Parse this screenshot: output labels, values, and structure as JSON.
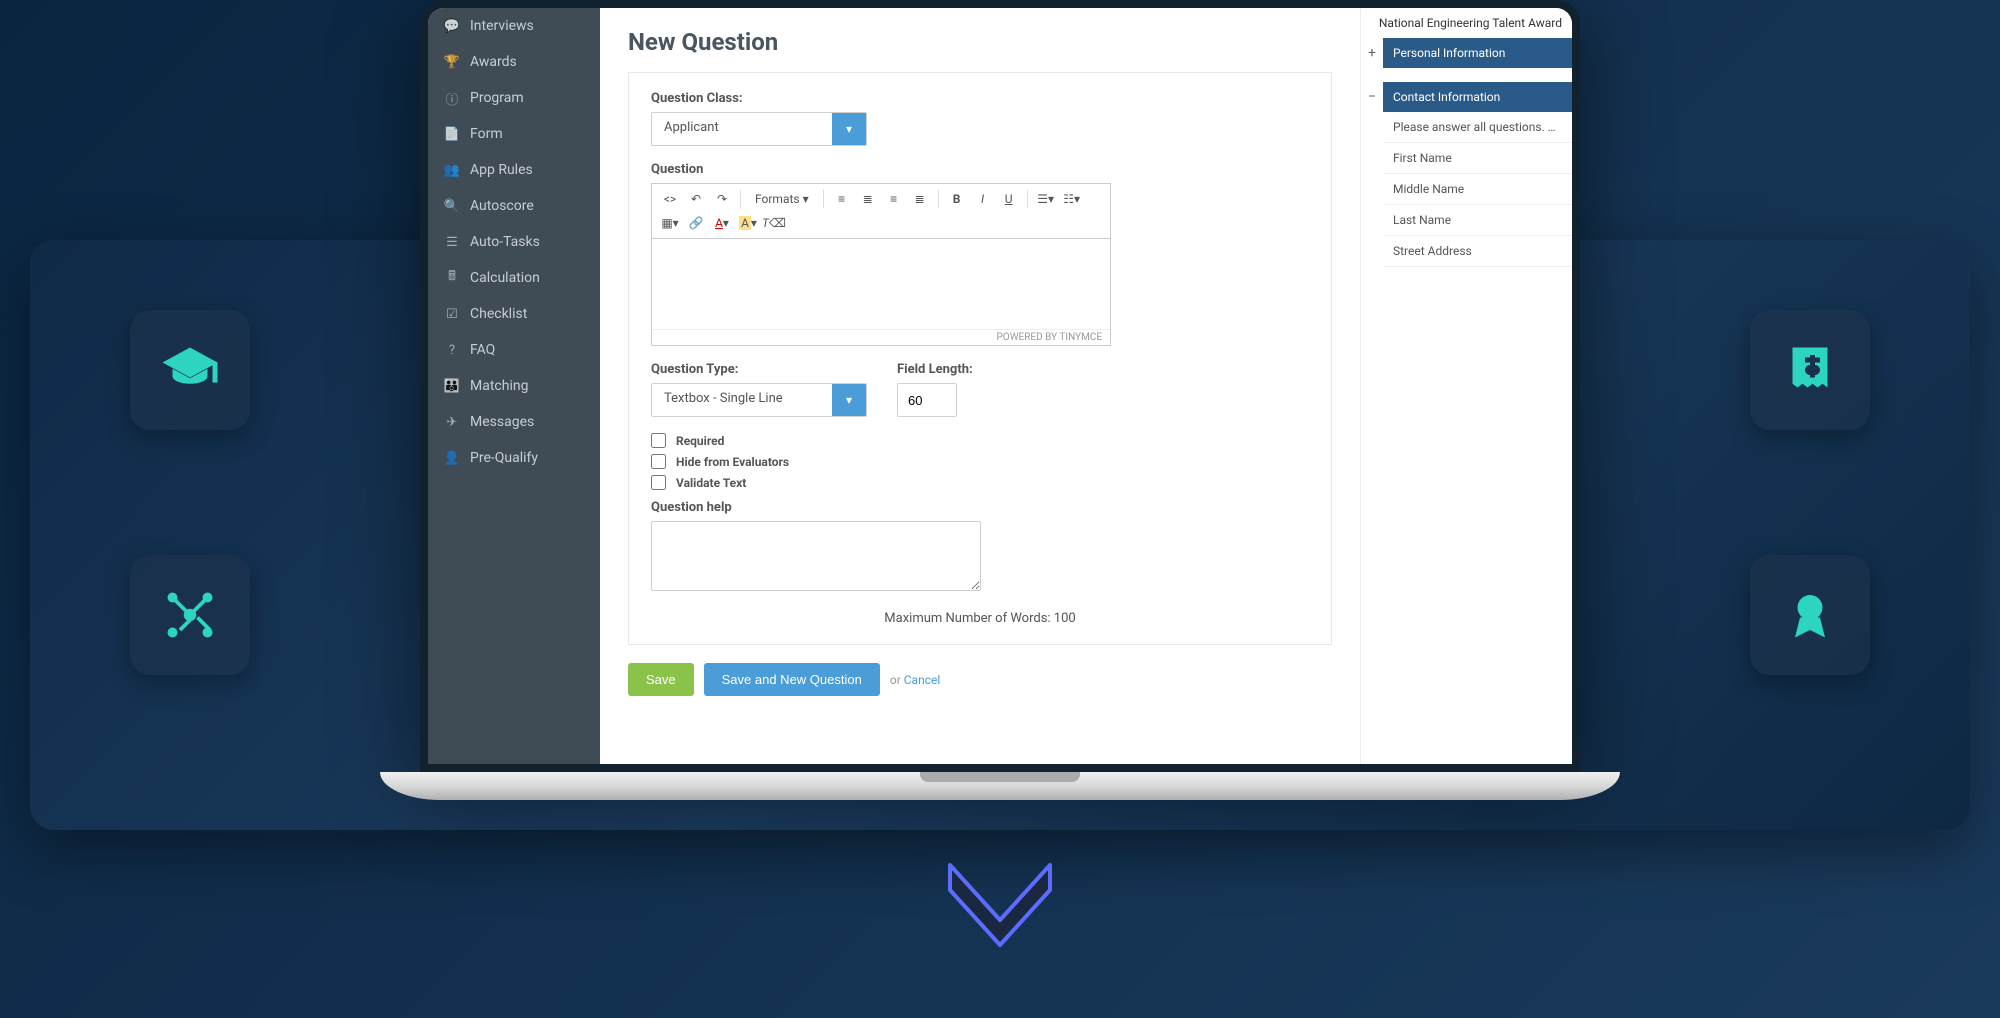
{
  "sidebar": {
    "items": [
      {
        "label": "Interviews",
        "icon": "💬"
      },
      {
        "label": "Awards",
        "icon": "🏆"
      },
      {
        "label": "Program",
        "icon": "ⓘ"
      },
      {
        "label": "Form",
        "icon": "📄"
      },
      {
        "label": "App Rules",
        "icon": "👥"
      },
      {
        "label": "Autoscore",
        "icon": "🔍"
      },
      {
        "label": "Auto-Tasks",
        "icon": "☰"
      },
      {
        "label": "Calculation",
        "icon": "🖩"
      },
      {
        "label": "Checklist",
        "icon": "☑"
      },
      {
        "label": "FAQ",
        "icon": "?"
      },
      {
        "label": "Matching",
        "icon": "👪"
      },
      {
        "label": "Messages",
        "icon": "✈"
      },
      {
        "label": "Pre-Qualify",
        "icon": "👤"
      }
    ]
  },
  "page": {
    "title": "New Question"
  },
  "form": {
    "question_class_label": "Question Class:",
    "question_class_value": "Applicant",
    "question_label": "Question",
    "editor_formats": "Formats ▾",
    "editor_powered": "POWERED BY TINYMCE",
    "question_type_label": "Question Type:",
    "question_type_value": "Textbox - Single Line",
    "field_length_label": "Field Length:",
    "field_length_value": "60",
    "checkbox_required": "Required",
    "checkbox_hide": "Hide from Evaluators",
    "checkbox_validate": "Validate Text",
    "question_help_label": "Question help",
    "max_words": "Maximum Number of Words: 100"
  },
  "actions": {
    "save": "Save",
    "save_new": "Save and New Question",
    "cancel_prefix": "or ",
    "cancel": "Cancel"
  },
  "rightpanel": {
    "title": "National Engineering Talent Award",
    "section_personal": "Personal Information",
    "section_contact": "Contact Information",
    "items": [
      "Please answer all questions. …",
      "First Name",
      "Middle Name",
      "Last Name",
      "Street Address"
    ]
  }
}
